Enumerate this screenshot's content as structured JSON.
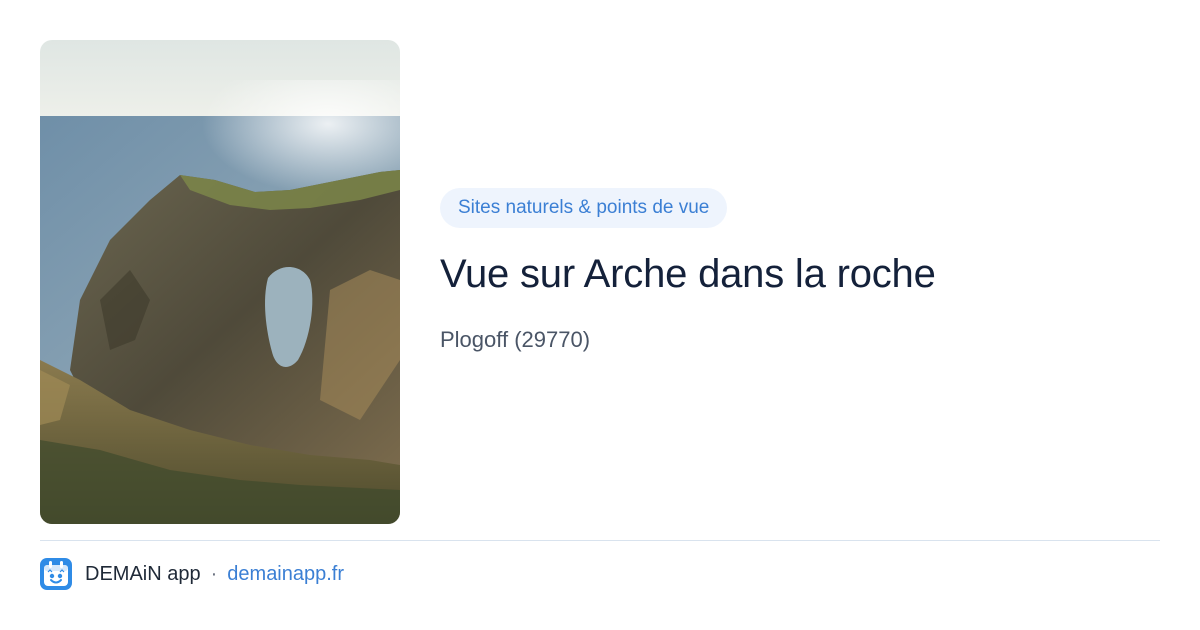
{
  "colors": {
    "accent": "#3b7fd4",
    "badge_bg": "#eef4fd",
    "title": "#14213a",
    "muted": "#4a5566",
    "divider": "#d9e3ee"
  },
  "photo": {
    "icon": "landscape-photo-sea-arch"
  },
  "place": {
    "category": "Sites naturels & points de vue",
    "title": "Vue sur Arche dans la roche",
    "location": "Plogoff (29770)"
  },
  "footer": {
    "app_icon": "demain-app-logo-icon",
    "app_name": "DEMAiN app",
    "separator": "·",
    "link_text": "demainapp.fr"
  }
}
